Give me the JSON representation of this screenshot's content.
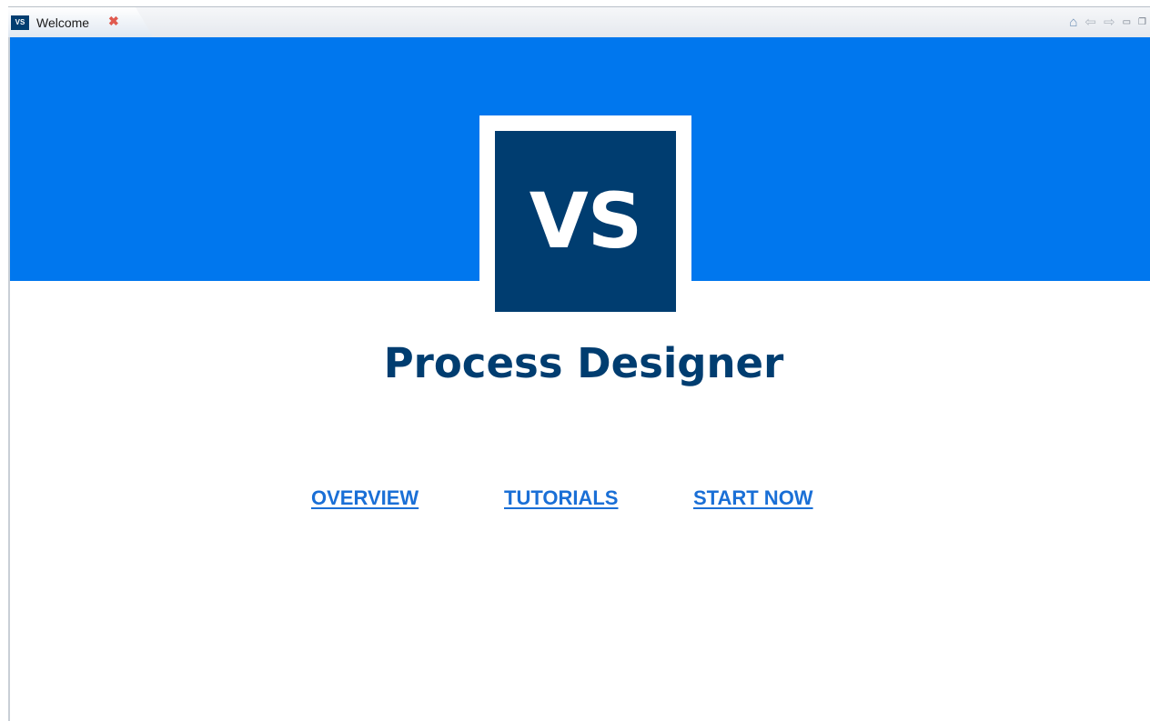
{
  "tab": {
    "icon_text": "VS",
    "label": "Welcome",
    "close_glyph": "✖"
  },
  "toolbar": {
    "home_icon": "home-icon",
    "back_icon": "back-arrow-icon",
    "forward_icon": "forward-arrow-icon",
    "minimize_icon": "minimize-icon",
    "maximize_icon": "maximize-icon"
  },
  "banner": {
    "color": "#0077ee",
    "logo_text": "VS",
    "logo_color": "#003d70"
  },
  "title": "Process Designer",
  "links": {
    "overview": "OVERVIEW",
    "tutorials": "TUTORIALS",
    "start_now": "START NOW"
  }
}
